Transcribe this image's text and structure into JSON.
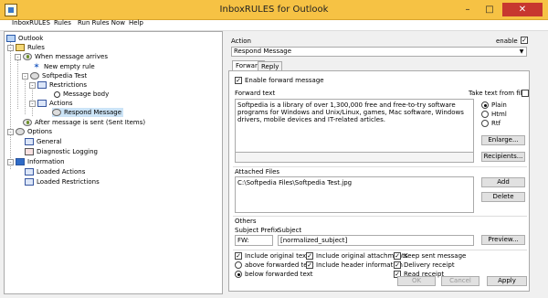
{
  "window": {
    "title": "InboxRULES for Outlook"
  },
  "menu": [
    "InboxRULES",
    "Rules",
    "Run Rules Now",
    "Help"
  ],
  "tree": {
    "root": "Outlook",
    "rules": "Rules",
    "when_arrives": "When message arrives",
    "new_empty_rule": "New empty rule",
    "softpedia_test": "Softpedia Test",
    "restrictions": "Restrictions",
    "message_body": "Message body",
    "actions": "Actions",
    "respond_message": "Respond Message",
    "after_sent": "After message is sent (Sent Items)",
    "options": "Options",
    "general": "General",
    "diagnostic_logging": "Diagnostic Logging",
    "information": "Information",
    "loaded_actions": "Loaded Actions",
    "loaded_restrictions": "Loaded Restrictions"
  },
  "action": {
    "label": "Action",
    "enable_label": "enable",
    "enable_checked": true,
    "value": "Respond Message"
  },
  "tabs": [
    "Forward",
    "Reply"
  ],
  "forward": {
    "enable_label": "Enable forward message",
    "forward_text_label": "Forward text",
    "take_text_label": "Take text from file",
    "text": "Softpedia is a library of over 1,300,000 free and free-to-try software programs for Windows and Unix/Linux, games, Mac software, Windows drivers, mobile devices and IT-related articles.",
    "formats": [
      "Plain",
      "Html",
      "Rtf"
    ],
    "enlarge": "Enlarge...",
    "recipients": "Recipients...",
    "attached_label": "Attached Files",
    "attached_file": "C:\\Softpedia Files\\Softpedia Test.jpg",
    "add": "Add",
    "delete": "Delete",
    "others_label": "Others",
    "subject_prefix_label": "Subject Prefix",
    "subject_label": "Subject",
    "subject_prefix": "FW:",
    "subject": "[normalized_subject]",
    "preview": "Preview...",
    "include_original_text": "Include original text",
    "above_forwarded": "above forwarded text",
    "below_forwarded": "below forwarded text",
    "include_attachments": "Include original attachments",
    "include_header": "Include header information",
    "keep_sent": "Keep sent message",
    "delivery_receipt": "Delivery receipt",
    "read_receipt": "Read receipt"
  },
  "buttons": {
    "ok": "OK",
    "cancel": "Cancel",
    "apply": "Apply"
  }
}
